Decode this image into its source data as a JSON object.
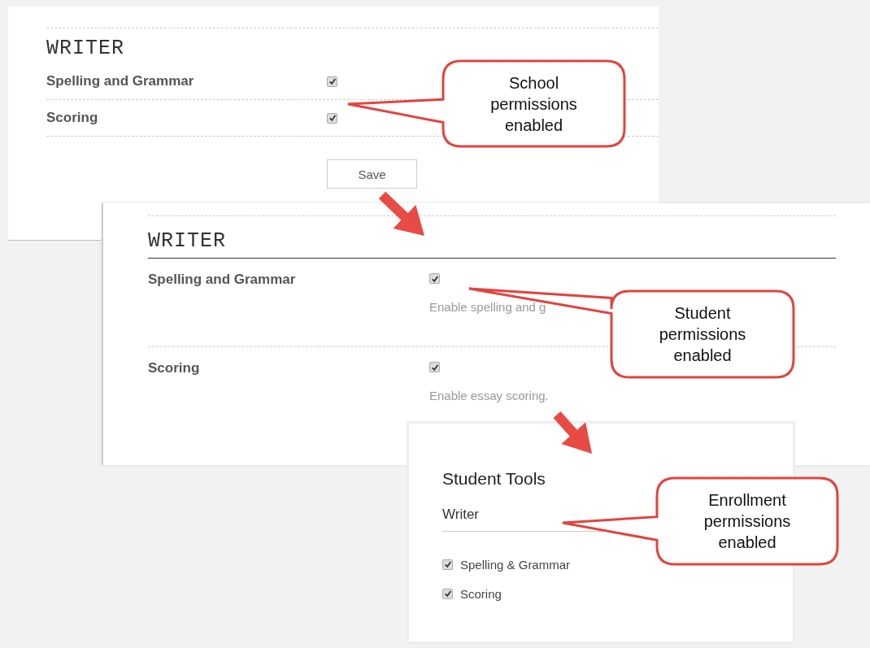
{
  "school_panel": {
    "heading": "WRITER",
    "rows": [
      {
        "label": "Spelling and Grammar",
        "checked": true
      },
      {
        "label": "Scoring",
        "checked": true
      }
    ],
    "save_button": "Save"
  },
  "student_panel": {
    "heading": "WRITER",
    "rows": [
      {
        "label": "Spelling and Grammar",
        "checked": true,
        "description": "Enable spelling and g"
      },
      {
        "label": "Scoring",
        "checked": true,
        "description": "Enable essay scoring."
      }
    ]
  },
  "enrollment_panel": {
    "title": "Student Tools",
    "section": "Writer",
    "options": [
      {
        "label": "Spelling & Grammar",
        "checked": true
      },
      {
        "label": "Scoring",
        "checked": true
      }
    ]
  },
  "callouts": [
    {
      "text": "School permissions enabled"
    },
    {
      "text": "Student permissions enabled"
    },
    {
      "text": "Enrollment permissions enabled"
    }
  ]
}
